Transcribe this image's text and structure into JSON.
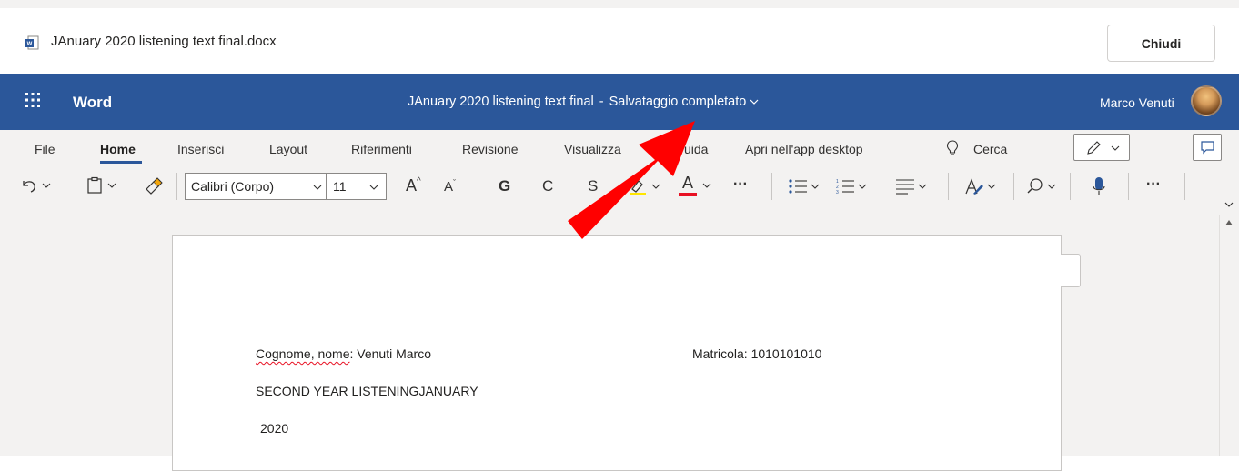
{
  "file_bar": {
    "file_name": "JAnuary 2020 listening text final.docx",
    "close_label": "Chiudi"
  },
  "word_bar": {
    "app_name": "Word",
    "doc_title": "JAnuary 2020 listening text final",
    "separator": "-",
    "save_status": "Salvataggio completato",
    "user_name": "Marco Venuti"
  },
  "tabs": [
    {
      "label": "File"
    },
    {
      "label": "Home"
    },
    {
      "label": "Inserisci"
    },
    {
      "label": "Layout"
    },
    {
      "label": "Riferimenti"
    },
    {
      "label": "Revisione"
    },
    {
      "label": "Visualizza"
    },
    {
      "label": "uida"
    },
    {
      "label": "Apri nell'app desktop"
    },
    {
      "label": "Cerca"
    }
  ],
  "toolbar": {
    "font_name": "Calibri (Corpo)",
    "font_size": "11",
    "bold": "G",
    "italic": "C",
    "underline": "S",
    "grow_font": "A",
    "shrink_font": "A",
    "font_color": "A",
    "more": "···"
  },
  "document": {
    "name_label": "Cognome, nome",
    "name_value": ": Venuti Marco",
    "id_line": "Matricola: 1010101010",
    "line2": "SECOND YEAR LISTENINGJANUARY",
    "line3": "2020"
  },
  "colors": {
    "word_blue": "#2b579a",
    "ribbon_bg": "#f3f2f1",
    "highlight_yellow": "#ffe600",
    "font_red": "#e81123",
    "arrow_red": "#ff0000"
  }
}
